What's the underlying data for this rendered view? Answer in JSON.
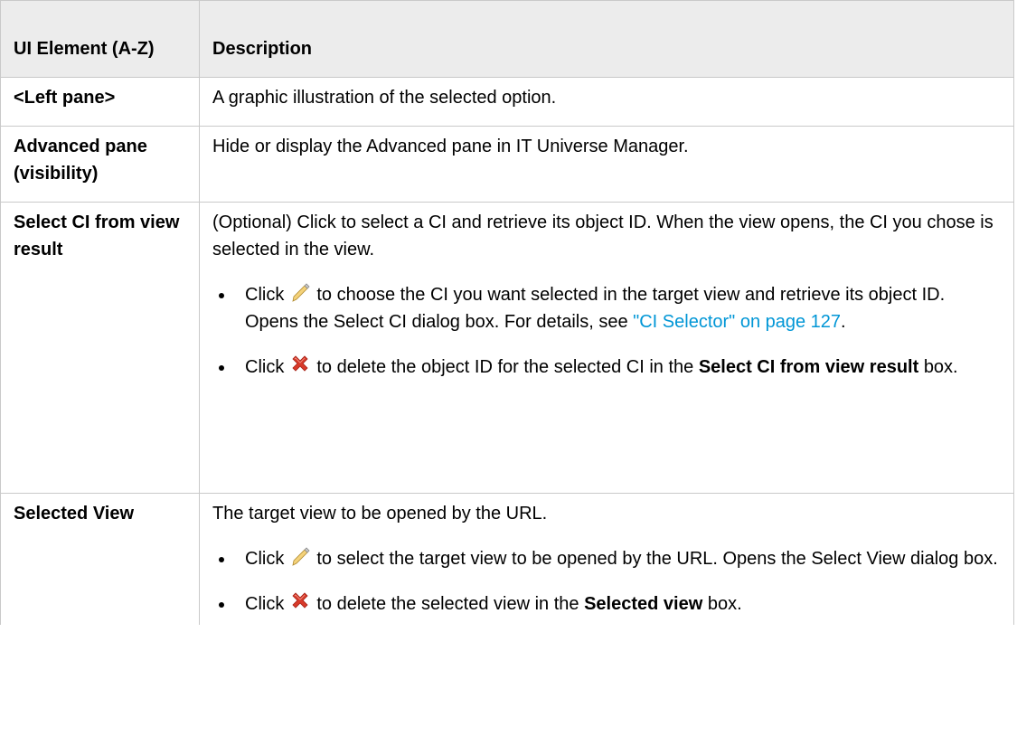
{
  "table": {
    "headers": {
      "col1": "UI Element (A-Z)",
      "col2": "Description"
    },
    "rows": [
      {
        "name": "<Left pane>",
        "description": "A graphic illustration of the selected option."
      },
      {
        "name": "Advanced pane (visibility)",
        "description": "Hide or display the Advanced pane in IT Universe Manager."
      },
      {
        "name": "Select CI from view result",
        "description": "(Optional) Click to select a CI and retrieve its object ID. When the view opens, the CI you chose is selected in the view.",
        "bullets": [
          {
            "click": "Click",
            "icon": "edit-pencil-icon",
            "text": "to choose the CI you want selected in the target view and retrieve its object ID. Opens the Select CI dialog box. For details, see",
            "link": "\"CI Selector\" on page 127",
            "after_link": "."
          },
          {
            "click": "Click",
            "icon": "delete-x-icon",
            "text": "to delete the object ID for the selected CI in the",
            "bold": "Select CI from view result",
            "after_bold": "box."
          }
        ]
      },
      {
        "name": "Selected View",
        "description": "The target view to be opened by the URL.",
        "bullets": [
          {
            "click": "Click",
            "icon": "edit-pencil-icon",
            "text": "to select the target view to be opened by the URL. Opens the Select View dialog box."
          },
          {
            "click": "Click",
            "icon": "delete-x-icon",
            "text": "to delete the selected view in the",
            "bold": "Selected view",
            "after_bold": "box."
          }
        ]
      }
    ]
  },
  "colors": {
    "header_bg": "#ececec",
    "border": "#c9c9c9",
    "link": "#0096d6",
    "delete_icon": "#d83a2a"
  }
}
